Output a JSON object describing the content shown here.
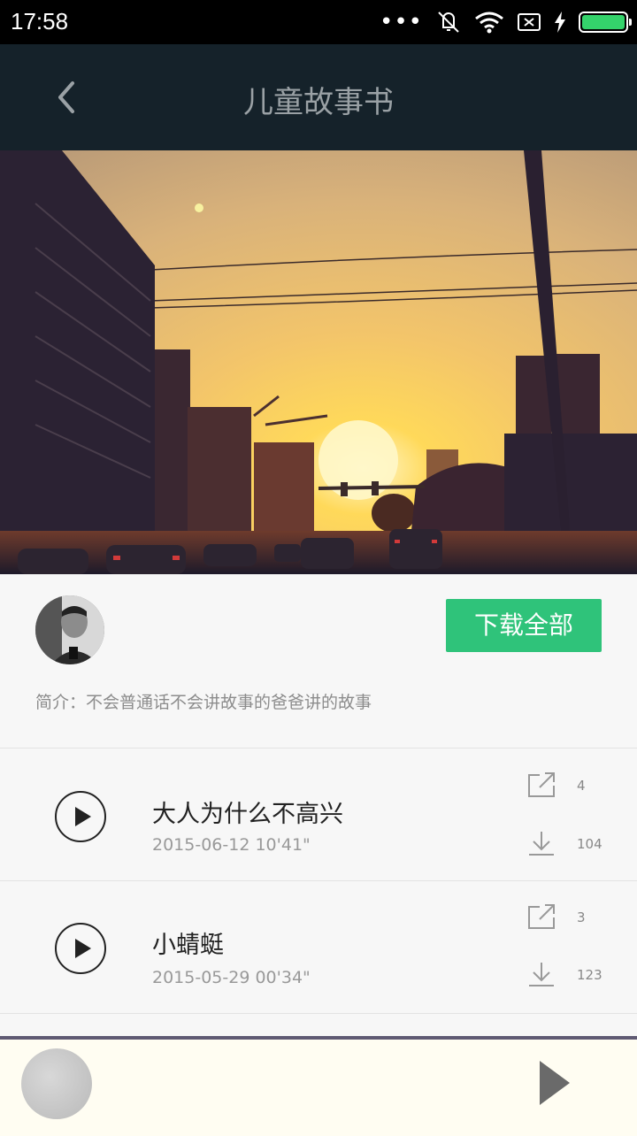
{
  "status_bar": {
    "time": "17:58",
    "battery_color": "#34d36b"
  },
  "header": {
    "title": "儿童故事书",
    "back_icon": "chevron-left-icon"
  },
  "album": {
    "download_all_label": "下载全部",
    "intro": "简介：不会普通话不会讲故事的爸爸讲的故事",
    "accent_color": "#2fc37a"
  },
  "tracks": [
    {
      "title": "大人为什么不高兴",
      "date": "2015-06-12",
      "duration": "10'41\"",
      "share_count": "4",
      "download_count": "104"
    },
    {
      "title": "小蜻蜓",
      "date": "2015-05-29",
      "duration": "00'34\"",
      "share_count": "3",
      "download_count": "123"
    }
  ],
  "mini_player": {
    "play_icon": "play-icon"
  }
}
